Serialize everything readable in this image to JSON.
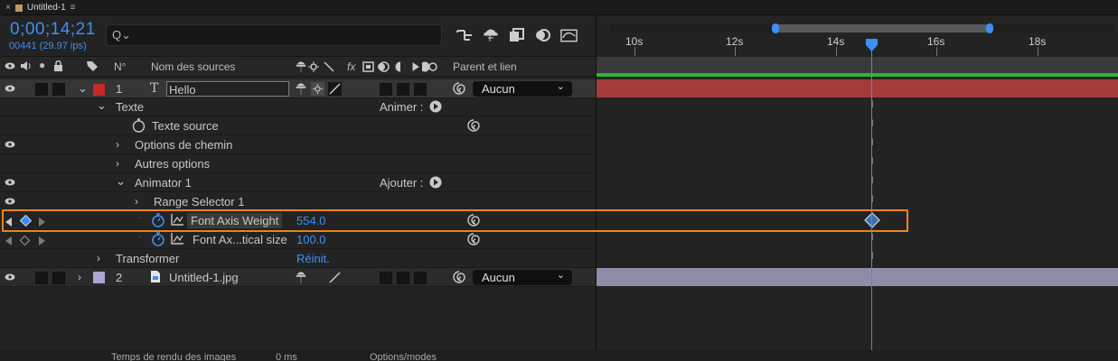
{
  "tab": {
    "close": "×",
    "title": "Untitled-1",
    "menu": "≡"
  },
  "timecode": "0;00;14;21",
  "frames": "00441 (29.97 ips)",
  "search": {
    "icon": "Q⌄",
    "value": ""
  },
  "columns": {
    "num": "N°",
    "source_name": "Nom des sources",
    "parent": "Parent et lien",
    "fx": "fx"
  },
  "ruler": {
    "ticks": [
      "10s",
      "12s",
      "14s",
      "16s",
      "18s"
    ]
  },
  "rows": {
    "layer1": {
      "num": "1",
      "type_icon": "T",
      "name": "Hello",
      "parent_value": "Aucun",
      "label_color": "#c42a2a"
    },
    "texte": "Texte",
    "animer": "Animer :",
    "texte_source": "Texte source",
    "options_chemin": "Options de chemin",
    "autres_options": "Autres options",
    "animator": "Animator 1",
    "ajouter": "Ajouter :",
    "range_selector": "Range Selector 1",
    "font_axis_weight": {
      "name": "Font Axis Weight",
      "value": "554.0"
    },
    "font_axis_vertical": {
      "name": "Font Ax...tical size",
      "value": "100.0"
    },
    "transformer": {
      "name": "Transformer",
      "reset": "Réinit."
    },
    "layer2": {
      "num": "2",
      "name": "Untitled-1.jpg",
      "parent_value": "Aucun",
      "label_color": "#a9a6d3"
    }
  },
  "bottombar": {
    "render_label": "Temps de rendu des images",
    "render_value": "0 ms",
    "toggle": "Options/modes"
  },
  "colors": {
    "accent": "#3d8ff3",
    "highlight": "#e8861f",
    "layer1_bar": "#a43c3c",
    "layer2_bar": "#8e8da8",
    "work_area": "#36b237"
  }
}
